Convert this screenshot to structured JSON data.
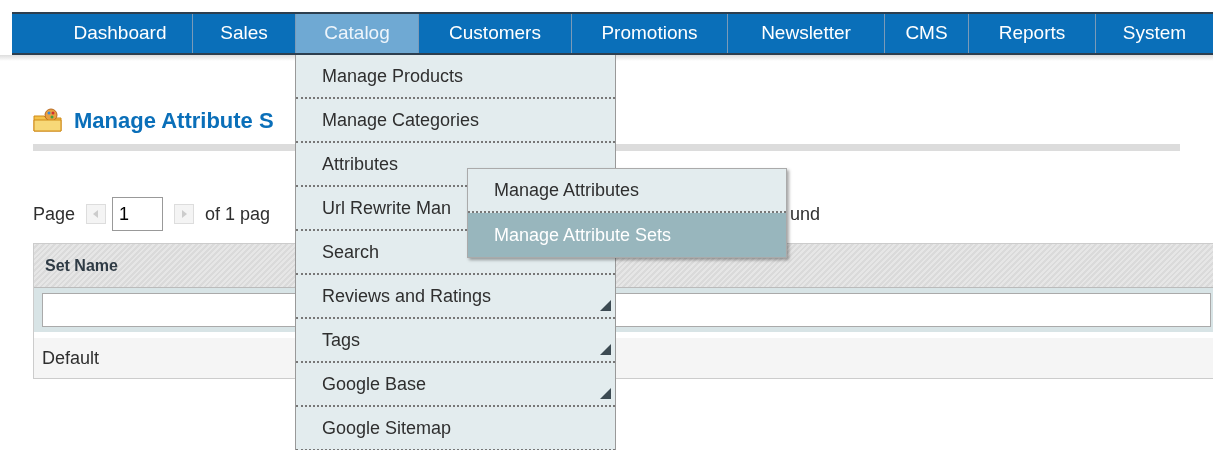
{
  "nav": [
    {
      "label": "Dashboard",
      "selected": false
    },
    {
      "label": "Sales",
      "selected": false
    },
    {
      "label": "Catalog",
      "selected": true
    },
    {
      "label": "Customers",
      "selected": false
    },
    {
      "label": "Promotions",
      "selected": false
    },
    {
      "label": "Newsletter",
      "selected": false
    },
    {
      "label": "CMS",
      "selected": false
    },
    {
      "label": "Reports",
      "selected": false
    },
    {
      "label": "System",
      "selected": false
    }
  ],
  "page": {
    "title": "Manage Attribute S",
    "pager": {
      "label": "Page",
      "page": "1",
      "of_pages": "of 1 pag",
      "found": "und"
    },
    "table": {
      "columns": [
        "Set Name"
      ],
      "rows": [
        [
          "Default"
        ]
      ]
    }
  },
  "catalog_menu": [
    {
      "label": "Manage Products",
      "arrow": false
    },
    {
      "label": "Manage Categories",
      "arrow": false
    },
    {
      "label": "Attributes",
      "arrow": false,
      "expanded": true,
      "children": [
        {
          "label": "Manage Attributes",
          "selected": false
        },
        {
          "label": "Manage Attribute Sets",
          "selected": true
        }
      ]
    },
    {
      "label": "Url Rewrite Man",
      "arrow": false
    },
    {
      "label": "Search",
      "arrow": false
    },
    {
      "label": "Reviews and Ratings",
      "arrow": true
    },
    {
      "label": "Tags",
      "arrow": true
    },
    {
      "label": "Google Base",
      "arrow": true
    },
    {
      "label": "Google Sitemap",
      "arrow": false
    }
  ]
}
